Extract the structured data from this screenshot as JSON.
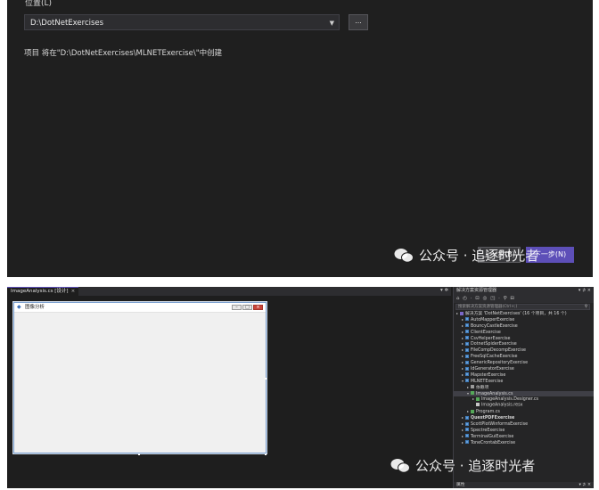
{
  "dialog": {
    "location_label": "位置(L)",
    "location_value": "D:\\DotNetExercises",
    "browse_label": "...",
    "info_text": "项目 将在\"D:\\DotNetExercises\\MLNETExercise\\\"中创建",
    "prev_button": "上一步(B)",
    "next_button": "下一步(N)"
  },
  "watermark": {
    "text": "公众号 · 追逐时光者"
  },
  "designer": {
    "doc_tab": "ImageAnalysis.cs [设计]",
    "doc_tab_close": "×",
    "tab_controls": "▾ ✲",
    "form_title": "图像分析",
    "form_buttons": {
      "min": "–",
      "max": "□",
      "close": "×"
    }
  },
  "solution_explorer": {
    "title": "解决方案资源管理器",
    "title_controls": "▾ ⊅ ×",
    "toolbar": "⌂ ◴ · ⊡ ◎ ◳ · ⚲ ⊟",
    "search_placeholder": "搜索解决方案资源管理器(Ctrl+;)",
    "search_icon": "⚲",
    "items": [
      {
        "label": "解决方案 'DotNetExercises' (16 个项目，共 16 个)",
        "icon": "solution",
        "indent": 0,
        "expander": "▸"
      },
      {
        "label": "AutoMapperExercise",
        "icon": "project",
        "indent": 1,
        "expander": "▸"
      },
      {
        "label": "BouncyCastleExercise",
        "icon": "project",
        "indent": 1,
        "expander": "▸"
      },
      {
        "label": "ClientExercise",
        "icon": "project",
        "indent": 1,
        "expander": "▸"
      },
      {
        "label": "CsvHelperExercise",
        "icon": "project",
        "indent": 1,
        "expander": "▸"
      },
      {
        "label": "DotnetSpiderExercise",
        "icon": "project",
        "indent": 1,
        "expander": "▸"
      },
      {
        "label": "FileCompDecompExercise",
        "icon": "project",
        "indent": 1,
        "expander": "▸"
      },
      {
        "label": "FreeSqlCacheExercise",
        "icon": "project",
        "indent": 1,
        "expander": "▸"
      },
      {
        "label": "GenericRepositoryExercise",
        "icon": "project",
        "indent": 1,
        "expander": "▸"
      },
      {
        "label": "IdGeneratorExercise",
        "icon": "project",
        "indent": 1,
        "expander": "▸"
      },
      {
        "label": "MapsterExercise",
        "icon": "project",
        "indent": 1,
        "expander": "▸"
      },
      {
        "label": "MLNETExercise",
        "icon": "project",
        "indent": 1,
        "expander": "▾"
      },
      {
        "label": "依赖项",
        "icon": "dependency",
        "indent": 2,
        "expander": "▸"
      },
      {
        "label": "ImageAnalysis.cs",
        "icon": "cs",
        "indent": 2,
        "expander": "▾",
        "selected": true
      },
      {
        "label": "ImageAnalysis.Designer.cs",
        "icon": "cs",
        "indent": 3,
        "expander": "▸"
      },
      {
        "label": "ImageAnalysis.resx",
        "icon": "file",
        "indent": 3,
        "expander": ""
      },
      {
        "label": "Program.cs",
        "icon": "cs",
        "indent": 2,
        "expander": "▸"
      },
      {
        "label": "QuestPDFExercise",
        "icon": "project",
        "indent": 1,
        "expander": "▸",
        "bold": true
      },
      {
        "label": "ScottPlotWinformsExercise",
        "icon": "project",
        "indent": 1,
        "expander": "▸"
      },
      {
        "label": "SpectreExercise",
        "icon": "project",
        "indent": 1,
        "expander": "▸"
      },
      {
        "label": "TerminalGuiExercise",
        "icon": "project",
        "indent": 1,
        "expander": "▸"
      },
      {
        "label": "ToneCrontabExercise",
        "icon": "project",
        "indent": 1,
        "expander": "▸"
      }
    ],
    "bottom_title": "属性",
    "bottom_controls": "▾ ⊅ ×"
  }
}
